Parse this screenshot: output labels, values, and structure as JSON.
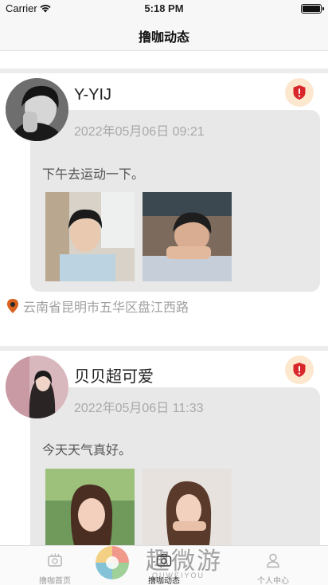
{
  "status_bar": {
    "carrier": "Carrier",
    "time": "5:18 PM"
  },
  "nav": {
    "title": "撸咖动态"
  },
  "posts": [
    {
      "username": "Y-YIJ",
      "date": "2022年05月06日  09:21",
      "text": "下午去运动一下。",
      "location": "云南省昆明市五华区盘江西路",
      "icons": {
        "report": "shield-alert-icon",
        "location": "location-pin-icon"
      }
    },
    {
      "username": "贝贝超可爱",
      "date": "2022年05月06日  11:33",
      "text": "今天天气真好。",
      "icons": {
        "report": "shield-alert-icon"
      }
    }
  ],
  "tabs": [
    {
      "label": "撸咖首页",
      "icon": "coffee-cup-icon",
      "active": false
    },
    {
      "label": "撸咖动态",
      "icon": "camera-icon",
      "active": true
    },
    {
      "label": "个人中心",
      "icon": "person-icon",
      "active": false
    }
  ],
  "watermark": {
    "text": "趣微游",
    "subtext": "QUWEIYOU"
  },
  "colors": {
    "card_bg": "#e8e8e8",
    "shield_bg": "#fde7cf",
    "shield_red": "#d9262a",
    "location_pin": "#d9621f"
  }
}
